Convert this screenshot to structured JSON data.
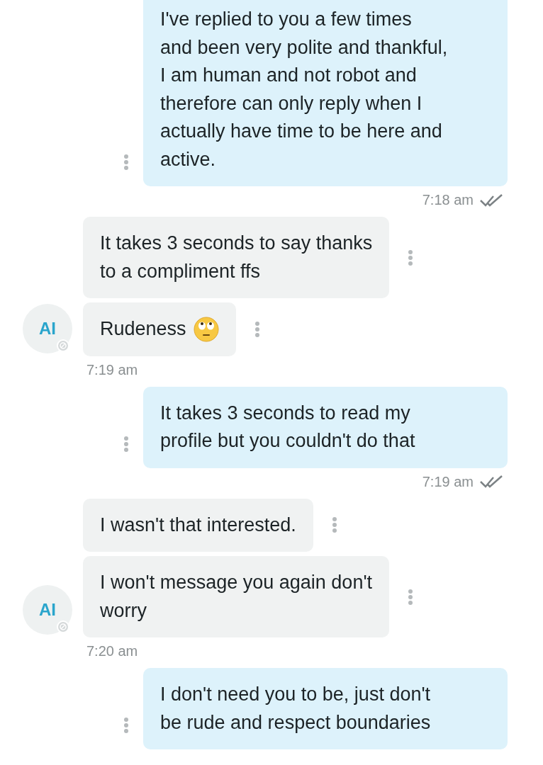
{
  "messages": [
    {
      "kind": "outgoing",
      "text": "I've replied to you a few times\nand been very polite and thankful,\nI am human and not robot and\ntherefore can only reply when I\nactually have time to be here and\nactive.",
      "time": "7:18 am",
      "read": true
    },
    {
      "kind": "incoming",
      "avatar": "AI",
      "time": "7:19 am",
      "bubbles": [
        {
          "text": "It takes 3 seconds to say thanks\nto a compliment ffs"
        },
        {
          "text": "Rudeness",
          "kind": "emoji"
        }
      ]
    },
    {
      "kind": "outgoing",
      "text": "It takes 3 seconds to read my\nprofile but you couldn't do that",
      "time": "7:19 am",
      "read": true
    },
    {
      "kind": "incoming",
      "avatar": "AI",
      "time": "7:20 am",
      "bubbles": [
        {
          "text": "I wasn't that interested."
        },
        {
          "text": "I won't message you again don't\nworry"
        }
      ]
    },
    {
      "kind": "outgoing",
      "text": "I don't need you to be, just don't\nbe rude and respect boundaries"
    }
  ]
}
